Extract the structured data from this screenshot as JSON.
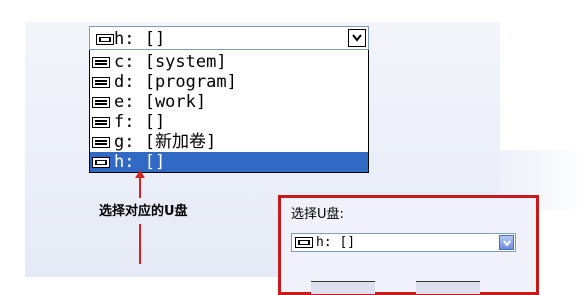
{
  "combo": {
    "value": "h: []"
  },
  "drive_list": [
    {
      "label": "c: [system]",
      "selected": false
    },
    {
      "label": "d: [program]",
      "selected": false
    },
    {
      "label": "e: [work]",
      "selected": false
    },
    {
      "label": "f: []",
      "selected": false
    },
    {
      "label": "g: [新加卷]",
      "selected": false
    },
    {
      "label": "h: []",
      "selected": true
    }
  ],
  "annotation": {
    "text": "选择对应的U盘"
  },
  "dialog": {
    "label": "选择U盘:",
    "combo_value": "h: []"
  },
  "colors": {
    "selection": "#316ac5",
    "annotation_red": "#c81a1a"
  },
  "icons": {
    "drive": "removable-drive-icon",
    "dropdown": "chevron-down-icon"
  }
}
